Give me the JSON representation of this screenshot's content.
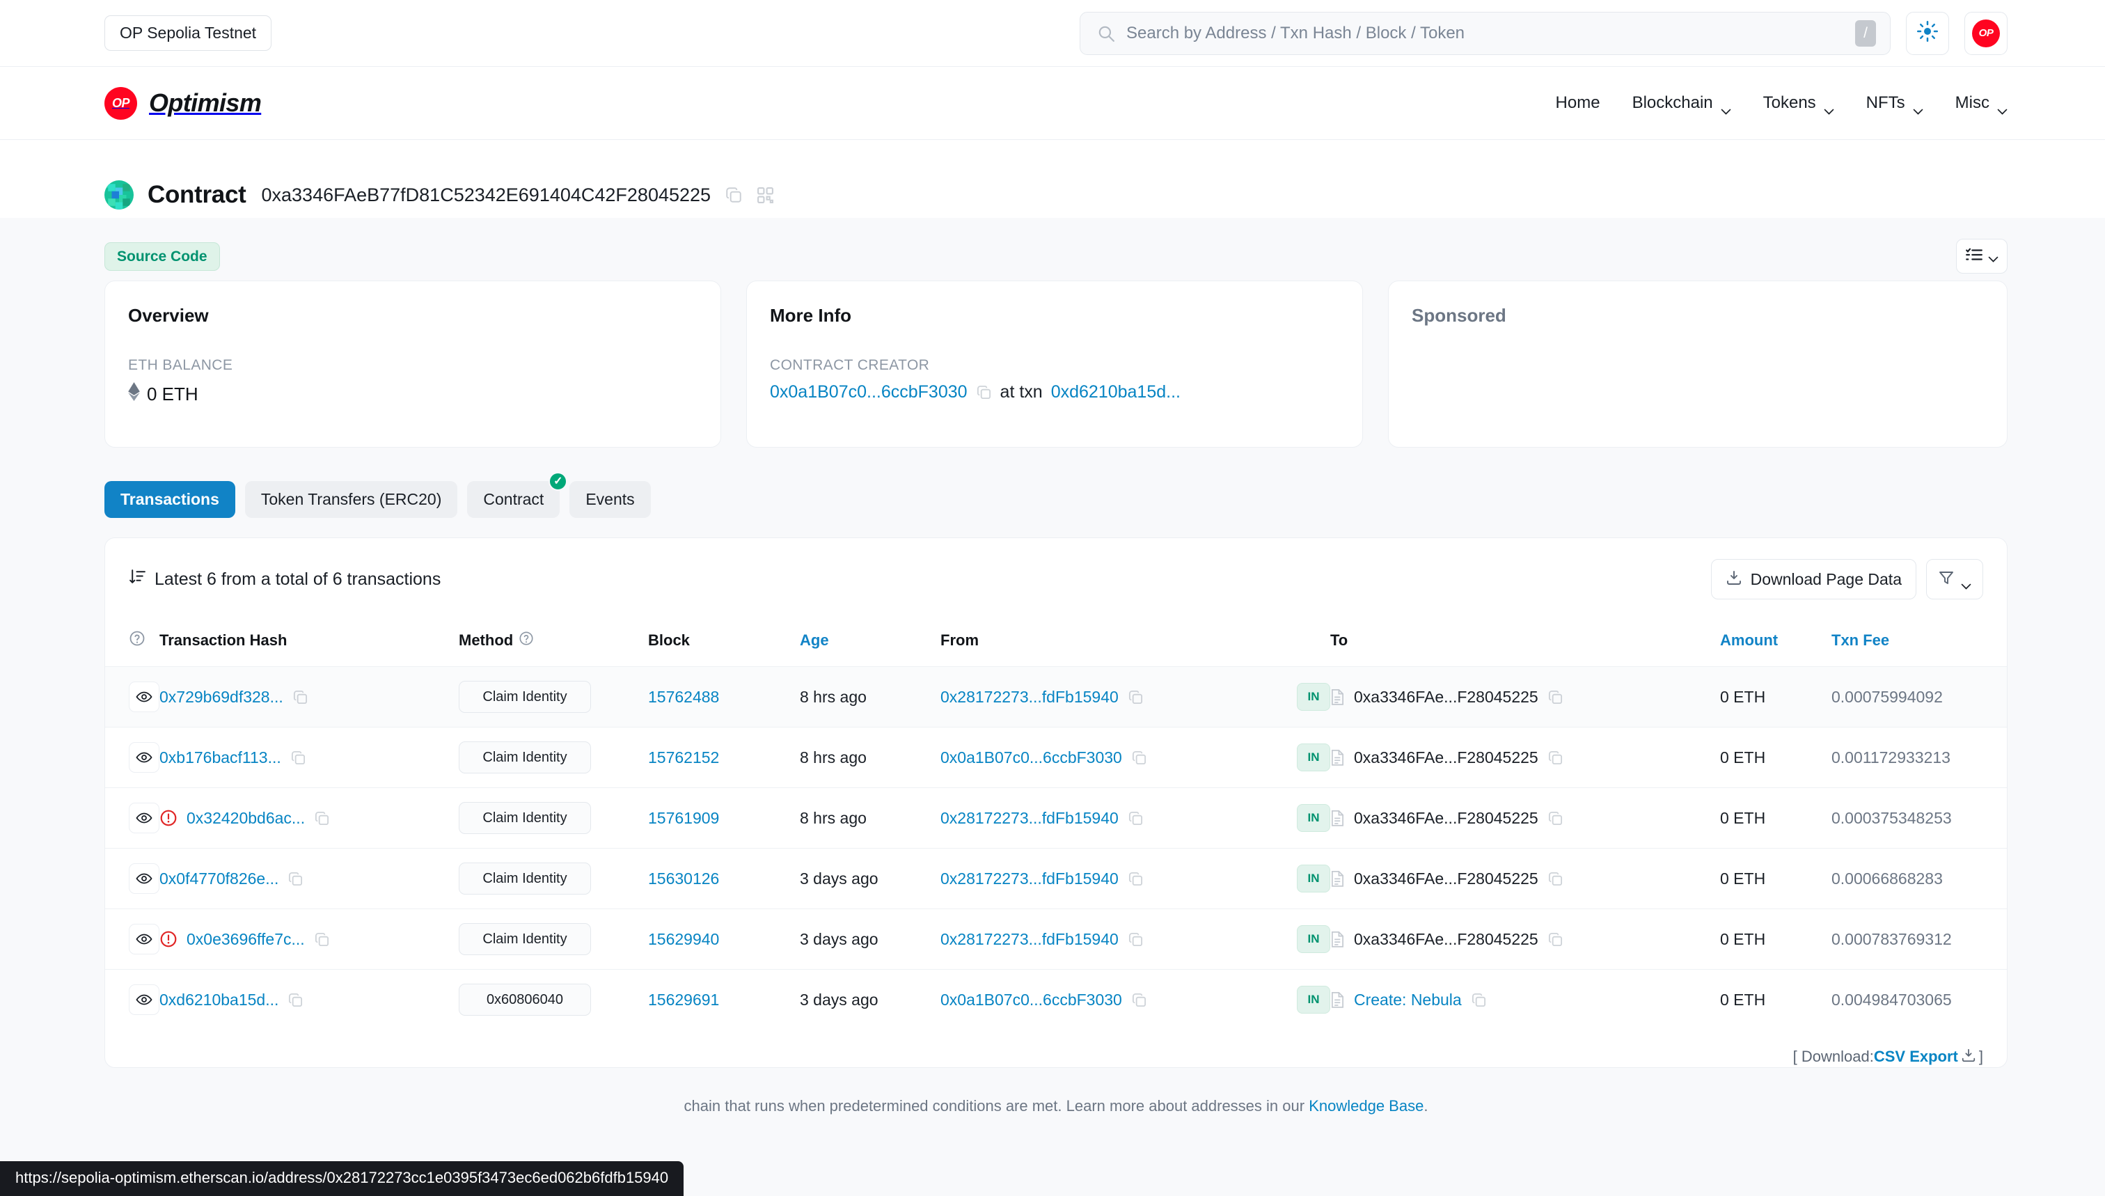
{
  "topbar": {
    "network_pill": "OP Sepolia Testnet",
    "search": {
      "placeholder": "Search by Address / Txn Hash / Block / Token",
      "value": "",
      "shortcut_key": "/"
    },
    "theme_toggle_icon": "sun-icon",
    "avatar_label": "OP"
  },
  "nav": {
    "brand_mark": "OP",
    "brand_name": "Optimism",
    "links": [
      {
        "label": "Home",
        "has_caret": false
      },
      {
        "label": "Blockchain",
        "has_caret": true
      },
      {
        "label": "Tokens",
        "has_caret": true
      },
      {
        "label": "NFTs",
        "has_caret": true
      },
      {
        "label": "Misc",
        "has_caret": true
      }
    ]
  },
  "header": {
    "title": "Contract",
    "address": "0xa3346FAeB77fD81C52342E691404C42F28045225",
    "copy_icon": "copy-icon",
    "qr_icon": "qr-code-icon"
  },
  "badges": {
    "source_code": "Source Code",
    "list_toggle_icon": "list-check-icon"
  },
  "cards": {
    "overview": {
      "title": "Overview",
      "balance_label": "ETH BALANCE",
      "balance_value": "0 ETH",
      "eth_icon": "ethereum-icon"
    },
    "more_info": {
      "title": "More Info",
      "creator_label": "CONTRACT CREATOR",
      "creator_address": "0x0a1B07c0...6ccbF3030",
      "at_txn_label": "at txn",
      "creator_txn": "0xd6210ba15d..."
    },
    "sponsored": {
      "title": "Sponsored"
    }
  },
  "tabs": [
    {
      "label": "Transactions",
      "active": true,
      "check": false
    },
    {
      "label": "Token Transfers (ERC20)",
      "active": false,
      "check": false
    },
    {
      "label": "Contract",
      "active": false,
      "check": true
    },
    {
      "label": "Events",
      "active": false,
      "check": false
    }
  ],
  "table": {
    "summary": "Latest 6 from a total of 6 transactions",
    "sort_icon": "sort-descending-icon",
    "download_button": "Download Page Data",
    "filter_icon": "filter-icon",
    "columns": [
      {
        "label": "",
        "icon": "question-circle-icon",
        "link": false
      },
      {
        "label": "Transaction Hash",
        "link": false
      },
      {
        "label": "Method",
        "icon": "question-circle-icon",
        "link": false
      },
      {
        "label": "Block",
        "link": false
      },
      {
        "label": "Age",
        "link": true
      },
      {
        "label": "From",
        "link": false
      },
      {
        "label": "",
        "link": false
      },
      {
        "label": "To",
        "link": false
      },
      {
        "label": "Amount",
        "link": true
      },
      {
        "label": "Txn Fee",
        "link": true
      }
    ],
    "rows": [
      {
        "hash": "0x729b69df328...",
        "error": false,
        "method": "Claim Identity",
        "block": "15762488",
        "age": "8 hrs ago",
        "from": "0x28172273...fdFb15940",
        "direction": "IN",
        "to": "0xa3346FAe...F28045225",
        "to_is_link": false,
        "to_has_doc": true,
        "amount": "0 ETH",
        "fee": "0.00075994092"
      },
      {
        "hash": "0xb176bacf113...",
        "error": false,
        "method": "Claim Identity",
        "block": "15762152",
        "age": "8 hrs ago",
        "from": "0x0a1B07c0...6ccbF3030",
        "direction": "IN",
        "to": "0xa3346FAe...F28045225",
        "to_is_link": false,
        "to_has_doc": true,
        "amount": "0 ETH",
        "fee": "0.001172933213"
      },
      {
        "hash": "0x32420bd6ac...",
        "error": true,
        "method": "Claim Identity",
        "block": "15761909",
        "age": "8 hrs ago",
        "from": "0x28172273...fdFb15940",
        "direction": "IN",
        "to": "0xa3346FAe...F28045225",
        "to_is_link": false,
        "to_has_doc": true,
        "amount": "0 ETH",
        "fee": "0.000375348253"
      },
      {
        "hash": "0x0f4770f826e...",
        "error": false,
        "method": "Claim Identity",
        "block": "15630126",
        "age": "3 days ago",
        "from": "0x28172273...fdFb15940",
        "direction": "IN",
        "to": "0xa3346FAe...F28045225",
        "to_is_link": false,
        "to_has_doc": true,
        "amount": "0 ETH",
        "fee": "0.00066868283"
      },
      {
        "hash": "0x0e3696ffe7c...",
        "error": true,
        "method": "Claim Identity",
        "block": "15629940",
        "age": "3 days ago",
        "from": "0x28172273...fdFb15940",
        "direction": "IN",
        "to": "0xa3346FAe...F28045225",
        "to_is_link": false,
        "to_has_doc": true,
        "amount": "0 ETH",
        "fee": "0.000783769312"
      },
      {
        "hash": "0xd6210ba15d...",
        "error": false,
        "method": "0x60806040",
        "block": "15629691",
        "age": "3 days ago",
        "from": "0x0a1B07c0...6ccbF3030",
        "direction": "IN",
        "to": "Create: Nebula",
        "to_is_link": true,
        "to_has_doc": true,
        "amount": "0 ETH",
        "fee": "0.004984703065"
      }
    ],
    "footer_prefix": "[ Download: ",
    "footer_link": "CSV Export",
    "footer_suffix": " ]"
  },
  "footer_note": {
    "text_before": "chain that runs when predetermined conditions are met. Learn more about addresses in our ",
    "link": "Knowledge Base",
    "text_after": "."
  },
  "status_bar": {
    "url": "https://sepolia-optimism.etherscan.io/address/0x28172273cc1e0395f3473ec6ed062b6fdfb15940"
  },
  "colors": {
    "accent_blue": "#1183c6",
    "link_blue": "#0784c3",
    "brand_red": "#ff0420",
    "green": "#00926f",
    "error_red": "#e02424"
  }
}
